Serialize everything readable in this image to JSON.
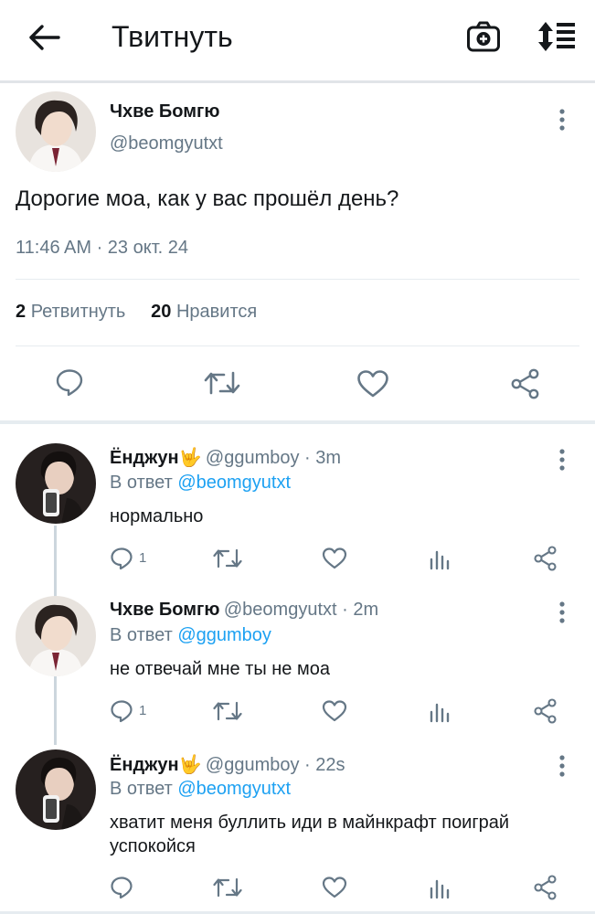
{
  "header": {
    "title": "Твитнуть",
    "back_icon": "arrow-left-icon",
    "camera_icon": "camera-plus-icon",
    "sort_icon": "sort-icon"
  },
  "tweet": {
    "name": "Чхве Бомгю",
    "handle": "@beomgyutxt",
    "text": "Дорогие моа, как у вас прошёл день?",
    "meta": "11:46 AM · 23 окт. 24",
    "retweets": "2",
    "retweets_label": "Ретвитнуть",
    "likes": "20",
    "likes_label": "Нравится"
  },
  "replies": [
    {
      "name": "Ёнджун🤟",
      "handle": "@ggumboy · 3m",
      "reply_to_label": "В ответ",
      "reply_to_handle": "@beomgyutxt",
      "text": "нормально",
      "reply_count": "1"
    },
    {
      "name": "Чхве Бомгю",
      "handle": "@beomgyutxt · 2m",
      "reply_to_label": "В ответ",
      "reply_to_handle": "@ggumboy",
      "text": "не отвечай мне ты не моа",
      "reply_count": "1"
    },
    {
      "name": "Ёнджун🤟",
      "handle": "@ggumboy · 22s",
      "reply_to_label": "В ответ",
      "reply_to_handle": "@beomgyutxt",
      "text": "хватит меня буллить иди в майнкрафт поиграй успокойся",
      "reply_count": ""
    }
  ],
  "colors": {
    "accent": "#1da1f2",
    "icon_gray": "#657786",
    "text": "#14171a"
  }
}
